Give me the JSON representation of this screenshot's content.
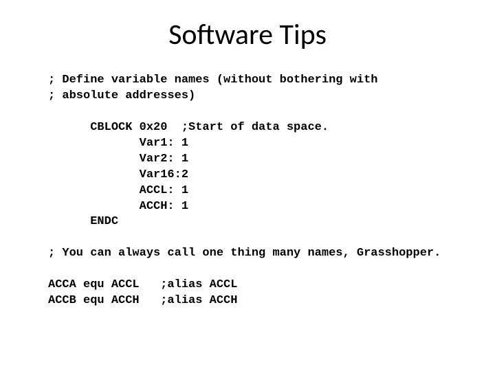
{
  "title": "Software Tips",
  "lines": {
    "c1": "; Define variable names (without bothering with",
    "c2": "; absolute addresses)",
    "blank1": "",
    "b0": "      CBLOCK 0x20  ;Start of data space.",
    "b1": "             Var1: 1",
    "b2": "             Var2: 1",
    "b3": "             Var16:2",
    "b4": "             ACCL: 1",
    "b5": "             ACCH: 1",
    "b6": "      ENDC",
    "blank2": "",
    "c3": "; You can always call one thing many names, Grasshopper.",
    "blank3": "",
    "a1": "ACCA equ ACCL   ;alias ACCL",
    "a2": "ACCB equ ACCH   ;alias ACCH"
  }
}
